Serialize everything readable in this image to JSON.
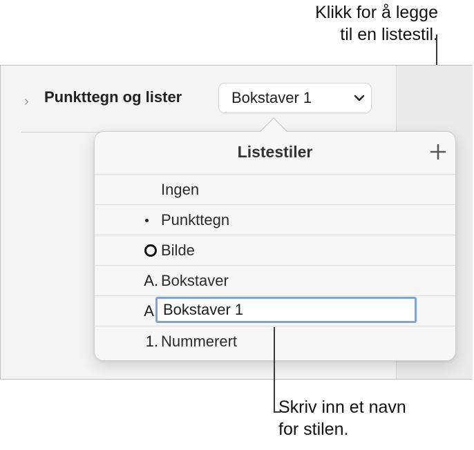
{
  "callouts": {
    "top": [
      "Klikk for å legge",
      "til en listestil."
    ],
    "bottom": [
      "Skriv inn et navn",
      "for stilen."
    ]
  },
  "sidebar": {
    "section_label": "Punkttegn og lister",
    "style_popup_value": "Bokstaver 1"
  },
  "popover": {
    "title": "Listestiler",
    "items": [
      {
        "marker": "",
        "label": "Ingen"
      },
      {
        "marker": "bullet-dot-icon",
        "label": "Punkttegn"
      },
      {
        "marker": "image-ring-icon",
        "label": "Bilde"
      },
      {
        "marker": "A.",
        "label": "Bokstaver"
      },
      {
        "marker": "A.",
        "label": "Bokstaver 1",
        "editing": true
      },
      {
        "marker": "1.",
        "label": "Nummerert"
      }
    ]
  },
  "icons": {
    "section_toggle": "chevron-right-icon",
    "popup_toggle": "chevron-down-icon",
    "add": "plus-icon"
  },
  "colors": {
    "focus_ring": "#7aa1ea",
    "panel_bg": "#f4f4f4"
  }
}
